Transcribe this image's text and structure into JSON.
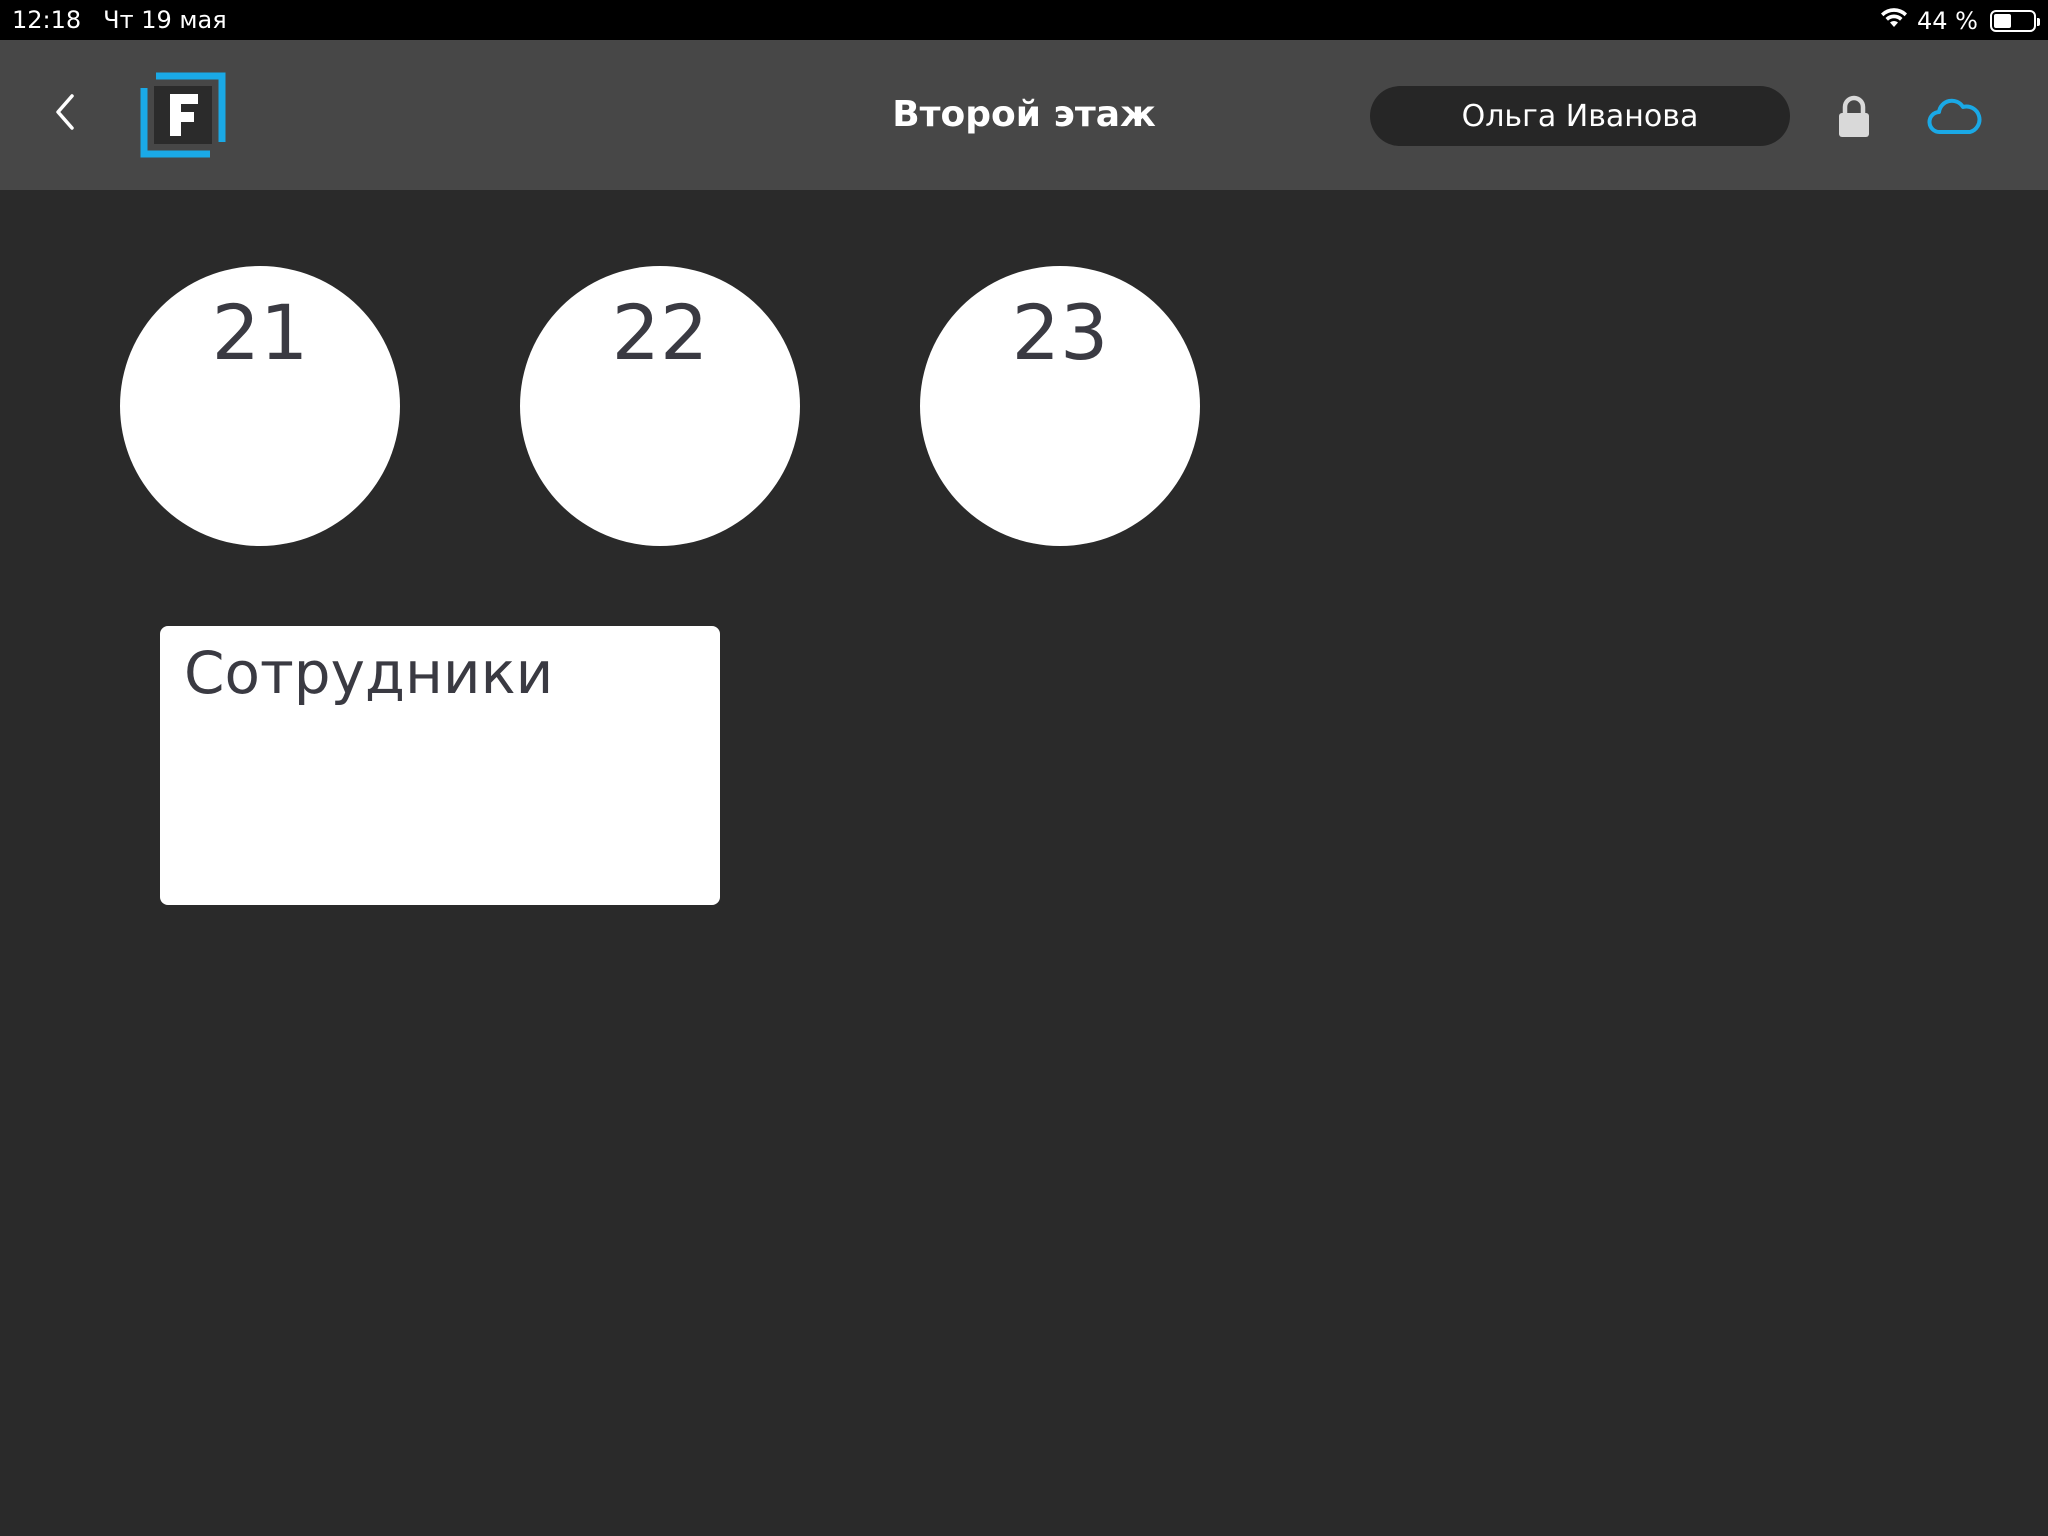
{
  "status_bar": {
    "time": "12:18",
    "date": "Чт 19 мая",
    "battery_text": "44 %",
    "battery_level": 0.44
  },
  "header": {
    "title": "Второй этаж",
    "user_name": "Ольга Иванова",
    "logo_letter": "F",
    "icons": {
      "back": "chevron-left-icon",
      "lock": "lock-icon",
      "cloud": "cloud-icon"
    }
  },
  "colors": {
    "accent": "#1aa9e6",
    "background": "#2a2a2a",
    "header": "#474747",
    "pill": "#262626",
    "item_text": "#3a3a42"
  },
  "tables": [
    {
      "number": "21"
    },
    {
      "number": "22"
    },
    {
      "number": "23"
    }
  ],
  "staff_card": {
    "label": "Сотрудники"
  }
}
